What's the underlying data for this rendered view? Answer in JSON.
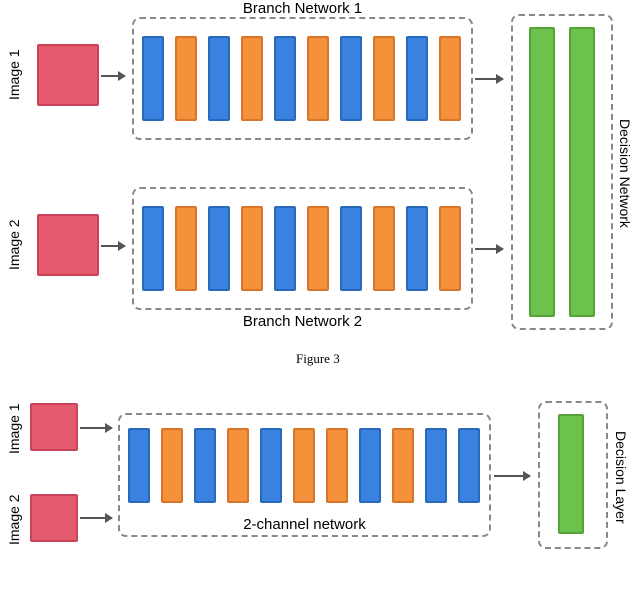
{
  "fig3": {
    "image1_label": "Image 1",
    "image2_label": "Image 2",
    "branch1_label": "Branch Network 1",
    "branch2_label": "Branch Network 2",
    "decision_label": "Decision Network",
    "caption": "Figure 3",
    "branch_layers": [
      "blue",
      "orange",
      "blue",
      "orange",
      "blue",
      "orange",
      "blue",
      "orange",
      "blue",
      "orange"
    ],
    "branch_layer_height": 85,
    "decision_layers": [
      "green",
      "green"
    ],
    "decision_layer_height": 290
  },
  "fig4": {
    "image1_label": "Image 1",
    "image2_label": "Image 2",
    "network_label": "2-channel network",
    "decision_label": "Decision Layer",
    "layers": [
      "blue",
      "orange",
      "blue",
      "orange",
      "blue",
      "orange",
      "orange",
      "blue",
      "orange",
      "blue",
      "blue"
    ],
    "layer_height": 75,
    "decision_layers": [
      "green"
    ],
    "decision_layer_height": 120
  },
  "colors": {
    "image_block": "#e65a6d",
    "conv_blue": "#3a82e0",
    "conv_orange": "#f5913b",
    "decision_green": "#6cc24a"
  }
}
